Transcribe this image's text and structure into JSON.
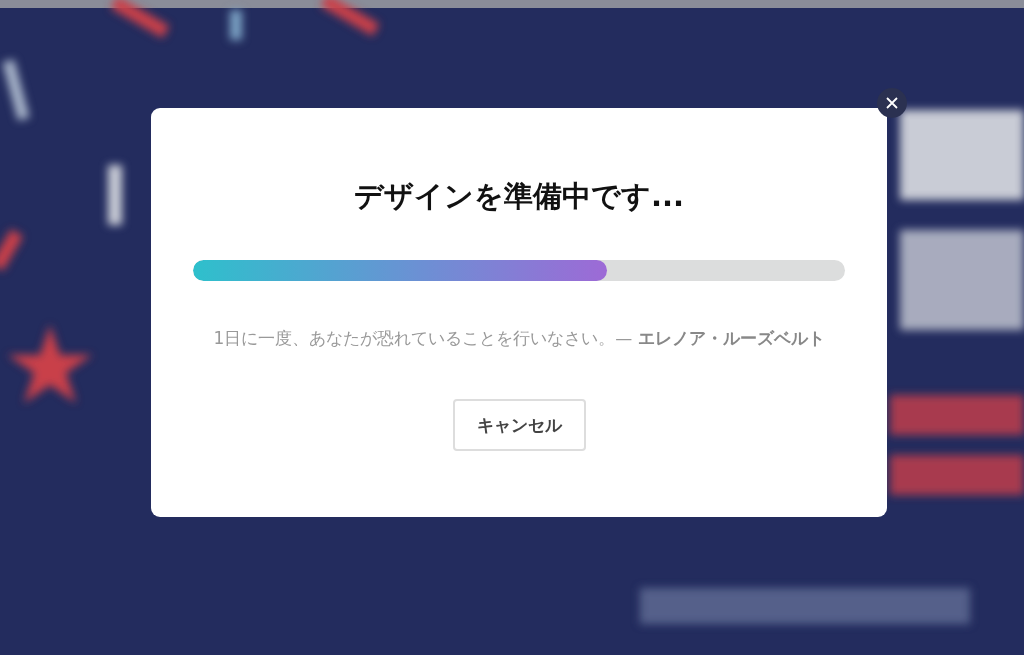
{
  "dialog": {
    "title": "デザインを準備中です...",
    "progress": {
      "level": 0.635
    },
    "quote": "1日に一度、あなたが恐れていることを行いなさい。— **エレノア・ルーズベルト**",
    "buttons": [
      "キャンセル"
    ]
  }
}
